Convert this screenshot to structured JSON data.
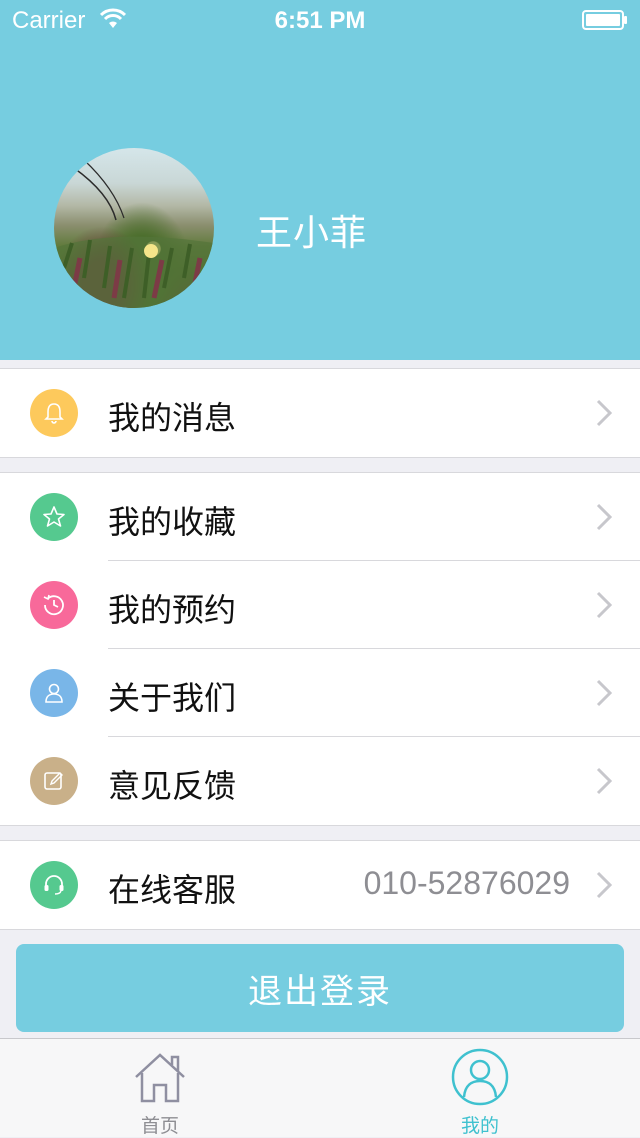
{
  "status_bar": {
    "carrier": "Carrier",
    "time": "6:51 PM"
  },
  "profile": {
    "username": "王小菲"
  },
  "menu_groups": {
    "messages": {
      "label": "我的消息",
      "icon": "bell-icon",
      "color": "#fdc95c"
    },
    "favorites": {
      "label": "我的收藏",
      "icon": "star-icon",
      "color": "#55c98f"
    },
    "appointments": {
      "label": "我的预约",
      "icon": "history-clock-icon",
      "color": "#f8699a"
    },
    "about": {
      "label": "关于我们",
      "icon": "person-icon",
      "color": "#79b6e8"
    },
    "feedback": {
      "label": "意见反馈",
      "icon": "edit-icon",
      "color": "#c9b089"
    },
    "service": {
      "label": "在线客服",
      "value": "010-52876029",
      "icon": "headset-icon",
      "color": "#55c98f"
    }
  },
  "logout_button": {
    "label": "退出登录"
  },
  "tabbar": {
    "home": {
      "label": "首页",
      "icon": "home-icon"
    },
    "mine": {
      "label": "我的",
      "icon": "user-circle-icon",
      "active_color": "#3fc1cf"
    }
  },
  "colors": {
    "header": "#76cde0",
    "background": "#efeff4"
  }
}
